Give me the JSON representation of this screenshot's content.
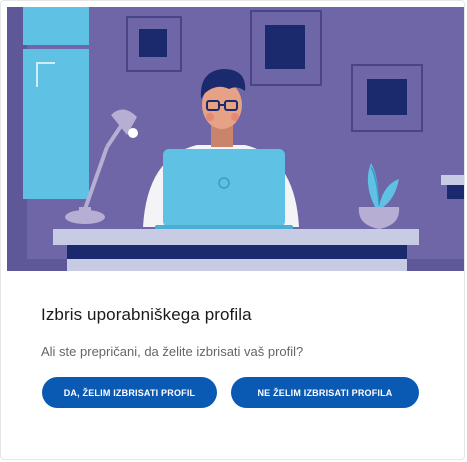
{
  "dialog": {
    "title": "Izbris uporabniškega profila",
    "question": "Ali ste prepričani, da želite izbrisati vaš profil?",
    "confirm_label": "DA, ŽELIM IZBRISATI PROFIL",
    "cancel_label": "NE ŽELIM IZBRISATI PROFILA"
  },
  "colors": {
    "wall": "#6e66a6",
    "accent_blue": "#5fc1e3",
    "navy": "#1a2a6c",
    "button": "#0a5ab4"
  },
  "illustration": {
    "subject": "person-at-laptop-illustration",
    "icons": [
      "desk-lamp-icon",
      "laptop-icon",
      "plant-icon",
      "picture-frame-icon"
    ]
  }
}
